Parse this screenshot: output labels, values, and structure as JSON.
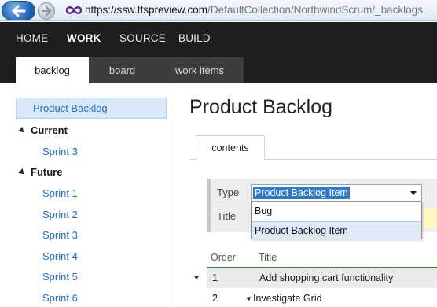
{
  "browser": {
    "url_host": "https://ssw.tfspreview.com",
    "url_path": "/DefaultCollection/NorthwindScrum/_backlogs",
    "icons": [
      "back-arrow-icon",
      "forward-arrow-icon",
      "site-logo-icon"
    ]
  },
  "topnav": {
    "items": [
      {
        "label": "HOME",
        "active": false
      },
      {
        "label": "WORK",
        "active": true
      },
      {
        "label": "SOURCE",
        "active": false
      },
      {
        "label": "BUILD",
        "active": false
      }
    ],
    "subtabs": [
      {
        "label": "backlog",
        "active": true
      },
      {
        "label": "board",
        "active": false
      },
      {
        "label": "work items",
        "active": false
      }
    ]
  },
  "sidebar": {
    "product_backlog": "Product Backlog",
    "groups": [
      {
        "label": "Current",
        "sprints": [
          "Sprint 3"
        ]
      },
      {
        "label": "Future",
        "sprints": [
          "Sprint 1",
          "Sprint 2",
          "Sprint 3",
          "Sprint 4",
          "Sprint 5",
          "Sprint 6"
        ]
      }
    ]
  },
  "main": {
    "title": "Product Backlog",
    "content_tab": "contents",
    "query": {
      "type_label": "Type",
      "type_value": "Product Backlog Item",
      "title_label": "Title",
      "options": [
        "Bug",
        "Product Backlog Item"
      ]
    },
    "grid": {
      "headers": [
        "Order",
        "Title"
      ],
      "rows": [
        {
          "order": "1",
          "title": "Add shopping cart functionality"
        },
        {
          "order": "2",
          "title": "Investigate Grid"
        }
      ]
    }
  },
  "colors": {
    "nav_bg": "#1e1e1e",
    "accent_link": "#1f6fbf",
    "selection": "#3178c6",
    "grid_header_line": "#2f8f3d"
  }
}
